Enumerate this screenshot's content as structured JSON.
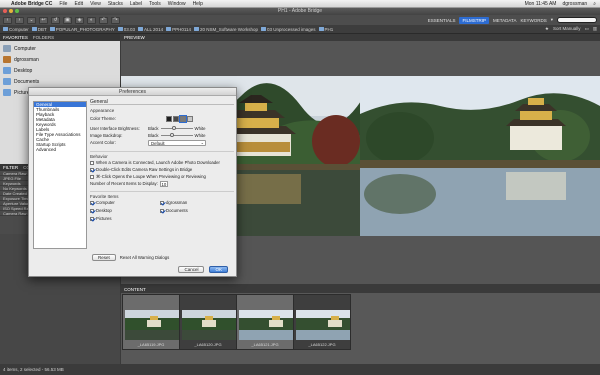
{
  "menubar": {
    "app_name": "Adobe Bridge CC",
    "items": [
      "File",
      "Edit",
      "View",
      "Stacks",
      "Label",
      "Tools",
      "Window",
      "Help"
    ],
    "clock": "Mon 11:45 AM",
    "user": "dgrossman"
  },
  "window": {
    "title": "PH1 - Adobe Bridge"
  },
  "toolbar": {
    "workspaces": [
      "ESSENTIALS",
      "FILMSTRIP",
      "METADATA",
      "KEYWORDS"
    ],
    "active_workspace": "FILMSTRIP"
  },
  "pathbar": {
    "crumbs": [
      "Computer",
      "DBT",
      "POPULAR_PHOTOGRAPHY",
      "03.03",
      "ALL 2014",
      "PPH0114",
      "20 NSM_Software Workshop",
      "03 Unprocessed images",
      "PH1"
    ],
    "sort": "Sort Manually"
  },
  "left_panel": {
    "tabs": [
      "FAVORITES",
      "FOLDERS"
    ],
    "favorites": [
      {
        "label": "Computer",
        "icon": "computer-icon",
        "color": "#8aa0b8"
      },
      {
        "label": "dgrossman",
        "icon": "home-icon",
        "color": "#b8752f"
      },
      {
        "label": "Desktop",
        "icon": "desktop-folder-icon",
        "color": "#6d9fd8"
      },
      {
        "label": "Documents",
        "icon": "documents-folder-icon",
        "color": "#6d9fd8"
      },
      {
        "label": "Pictures",
        "icon": "pictures-folder-icon",
        "color": "#6d9fd8"
      }
    ],
    "filter_tabs": [
      "FILTER",
      "COLLECTIONS"
    ],
    "filter_items": [
      "Camera Raw",
      "JPEG File",
      "Keywords",
      "No Keywords",
      "Date Created",
      "Exposure Time",
      "Aperture Value",
      "ISO Speed Ratings",
      "Camera Raw Settings"
    ]
  },
  "preview": {
    "label": "PREVIEW"
  },
  "content": {
    "label": "CONTENT",
    "thumbnails": [
      {
        "caption": "_LA65119.JPG",
        "selected": true
      },
      {
        "caption": "_LA65120.JPG",
        "selected": false
      },
      {
        "caption": "_LA65121.JPG",
        "selected": true
      },
      {
        "caption": "_LA65122.JPG",
        "selected": false
      }
    ]
  },
  "status": {
    "text": "4 items, 2 selected - 56.53 MB"
  },
  "preferences": {
    "title": "Preferences",
    "categories": [
      "General",
      "Thumbnails",
      "Playback",
      "Metadata",
      "Keywords",
      "Labels",
      "File Type Associations",
      "Cache",
      "Startup Scripts",
      "Advanced"
    ],
    "selected_category": "General",
    "pane_title": "General",
    "appearance_label": "Appearance",
    "color_theme_label": "Color Theme:",
    "theme_colors": [
      "#1e1e1e",
      "#4a4a4a",
      "#7a7a7a",
      "#c8c8c8"
    ],
    "ui_brightness_label": "User Interface Brightness:",
    "ui_brightness_value": 0.35,
    "image_backdrop_label": "Image Backdrop:",
    "image_backdrop_value": 0.3,
    "black_label": "Black",
    "white_label": "White",
    "accent_label": "Accent Color:",
    "accent_value": "Default",
    "behavior_label": "Behavior",
    "behavior_options": [
      {
        "label": "When a Camera is Connected, Launch Adobe Photo Downloader",
        "checked": false
      },
      {
        "label": "Double-Click Edits Camera Raw Settings in Bridge",
        "checked": true
      },
      {
        "label": "⌘-Click Opens the Loupe When Previewing or Reviewing",
        "checked": false
      }
    ],
    "recent_items_label": "Number of Recent Items to Display:",
    "recent_items_value": "10",
    "favorite_items_label": "Favorite Items",
    "favorite_items": [
      {
        "label": "Computer",
        "checked": true
      },
      {
        "label": "dgrossman",
        "checked": true
      },
      {
        "label": "Desktop",
        "checked": true
      },
      {
        "label": "Documents",
        "checked": true
      },
      {
        "label": "Pictures",
        "checked": true
      }
    ],
    "reset_label": "Reset",
    "reset_warnings_label": "Reset All Warning Dialogs",
    "cancel_label": "Cancel",
    "ok_label": "OK"
  }
}
